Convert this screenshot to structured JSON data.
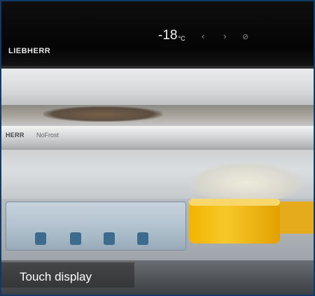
{
  "panel": {
    "brand": "LIEBHERR",
    "temperature": "-18",
    "temperature_unit": "°C",
    "controls": [
      {
        "icon": "chevron-left-icon",
        "glyph": "‹"
      },
      {
        "icon": "chevron-right-icon",
        "glyph": "›"
      },
      {
        "icon": "check-circle-icon",
        "glyph": "⊘"
      }
    ]
  },
  "rail": {
    "brand": "HERR",
    "sub": "NoFrost"
  },
  "caption": "Touch display",
  "colors": {
    "panel": "#050505",
    "frame": "#123a66",
    "jar": "#f1b400"
  }
}
